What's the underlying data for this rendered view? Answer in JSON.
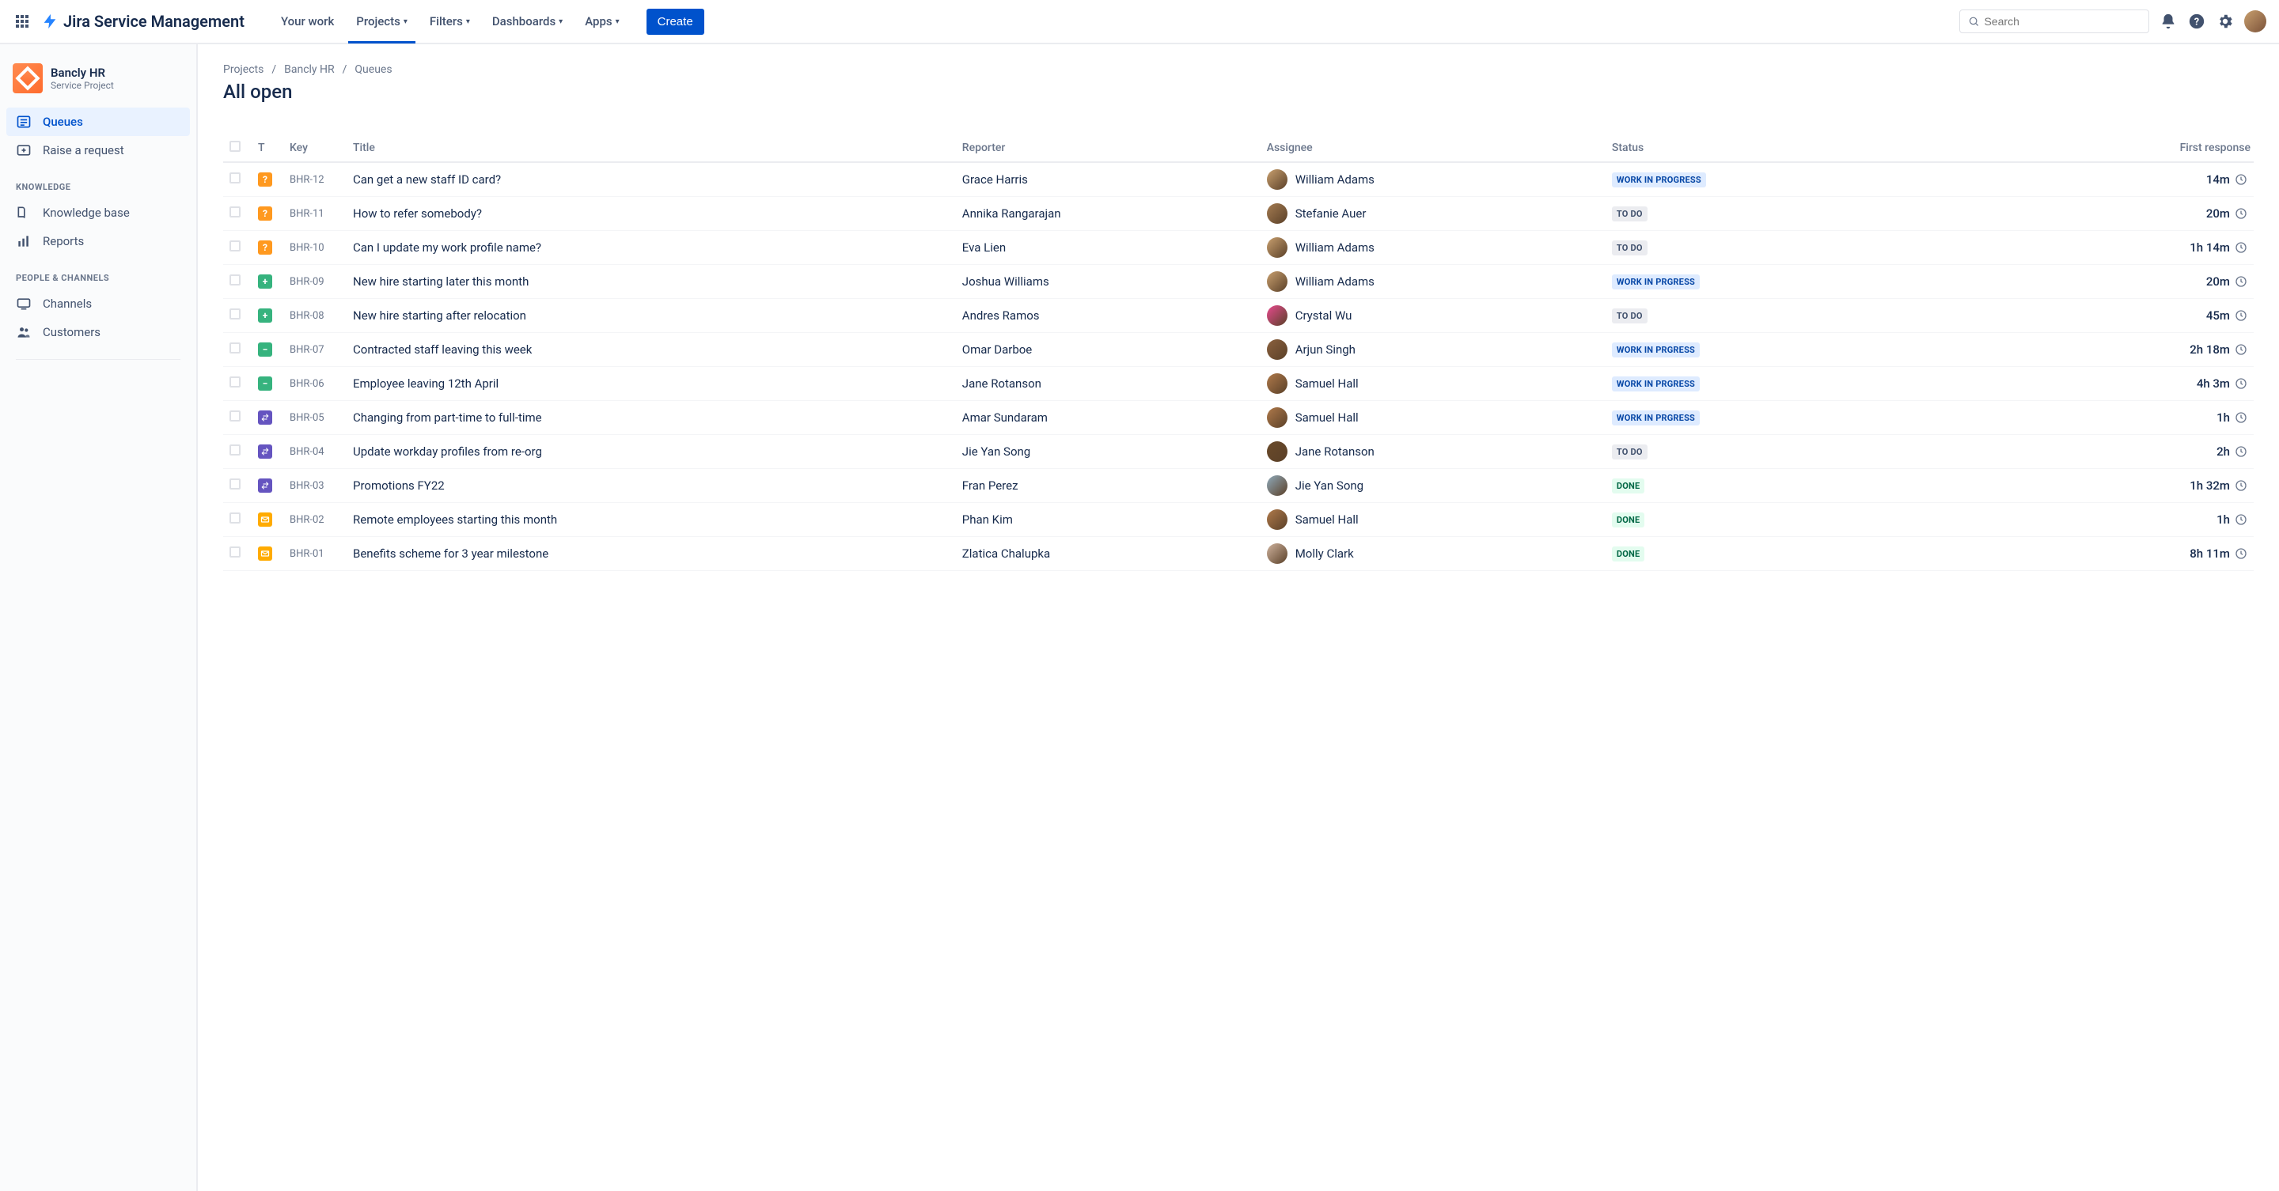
{
  "app": {
    "name": "Jira Service Management"
  },
  "nav": {
    "your_work": "Your work",
    "projects": "Projects",
    "filters": "Filters",
    "dashboards": "Dashboards",
    "apps": "Apps",
    "create": "Create"
  },
  "search": {
    "placeholder": "Search"
  },
  "sidebar": {
    "project_name": "Bancly HR",
    "project_type": "Service Project",
    "items": {
      "queues": "Queues",
      "raise": "Raise a request",
      "knowledge_group": "KNOWLEDGE",
      "knowledge_base": "Knowledge base",
      "reports": "Reports",
      "people_group": "PEOPLE & CHANNELS",
      "channels": "Channels",
      "customers": "Customers"
    }
  },
  "breadcrumbs": {
    "projects": "Projects",
    "project": "Bancly HR",
    "section": "Queues"
  },
  "page": {
    "title": "All open"
  },
  "columns": {
    "t": "T",
    "key": "Key",
    "title": "Title",
    "reporter": "Reporter",
    "assignee": "Assignee",
    "status": "Status",
    "first_response": "First response"
  },
  "status_labels": {
    "wip": "WORK IN PROGRESS",
    "wip2": "WORK IN PRGRESS",
    "todo": "TO DO",
    "done": "DONE"
  },
  "rows": [
    {
      "type": "question",
      "key": "BHR-12",
      "title": "Can get a new staff ID card?",
      "reporter": "Grace Harris",
      "assignee": "William Adams",
      "avcolor": "#c9a06f",
      "status": "wip",
      "first_response": "14m"
    },
    {
      "type": "question",
      "key": "BHR-11",
      "title": "How to refer somebody?",
      "reporter": "Annika Rangarajan",
      "assignee": "Stefanie Auer",
      "avcolor": "#a57c52",
      "status": "todo",
      "first_response": "20m"
    },
    {
      "type": "question",
      "key": "BHR-10",
      "title": "Can I update my work profile name?",
      "reporter": "Eva Lien",
      "assignee": "William Adams",
      "avcolor": "#c9a06f",
      "status": "todo",
      "first_response": "1h 14m"
    },
    {
      "type": "plus",
      "key": "BHR-09",
      "title": "New hire starting later this month",
      "reporter": "Joshua Williams",
      "assignee": "William Adams",
      "avcolor": "#c9a06f",
      "status": "wip2",
      "first_response": "20m"
    },
    {
      "type": "plus",
      "key": "BHR-08",
      "title": "New hire starting after relocation",
      "reporter": "Andres Ramos",
      "assignee": "Crystal Wu",
      "avcolor": "#e84a8f",
      "status": "todo",
      "first_response": "45m"
    },
    {
      "type": "minus",
      "key": "BHR-07",
      "title": "Contracted staff leaving this week",
      "reporter": "Omar Darboe",
      "assignee": "Arjun Singh",
      "avcolor": "#8b613e",
      "status": "wip2",
      "first_response": "2h 18m"
    },
    {
      "type": "minus",
      "key": "BHR-06",
      "title": "Employee leaving 12th April",
      "reporter": "Jane Rotanson",
      "assignee": "Samuel Hall",
      "avcolor": "#b07a4b",
      "status": "wip2",
      "first_response": "4h 3m"
    },
    {
      "type": "swap",
      "key": "BHR-05",
      "title": "Changing from part-time to full-time",
      "reporter": "Amar Sundaram",
      "assignee": "Samuel Hall",
      "avcolor": "#b07a4b",
      "status": "wip2",
      "first_response": "1h"
    },
    {
      "type": "swap",
      "key": "BHR-04",
      "title": "Update workday profiles from re-org",
      "reporter": "Jie Yan Song",
      "assignee": "Jane Rotanson",
      "avcolor": "#6a4a2a",
      "status": "todo",
      "first_response": "2h"
    },
    {
      "type": "swap",
      "key": "BHR-03",
      "title": "Promotions FY22",
      "reporter": "Fran Perez",
      "assignee": "Jie Yan Song",
      "avcolor": "#8faabb",
      "status": "done",
      "first_response": "1h 32m"
    },
    {
      "type": "mail",
      "key": "BHR-02",
      "title": "Remote employees starting this month",
      "reporter": "Phan Kim",
      "assignee": "Samuel Hall",
      "avcolor": "#b07a4b",
      "status": "done",
      "first_response": "1h"
    },
    {
      "type": "mail",
      "key": "BHR-01",
      "title": "Benefits scheme for 3 year milestone",
      "reporter": "Zlatica Chalupka",
      "assignee": "Molly Clark",
      "avcolor": "#d0b49f",
      "status": "done",
      "first_response": "8h 11m"
    }
  ]
}
